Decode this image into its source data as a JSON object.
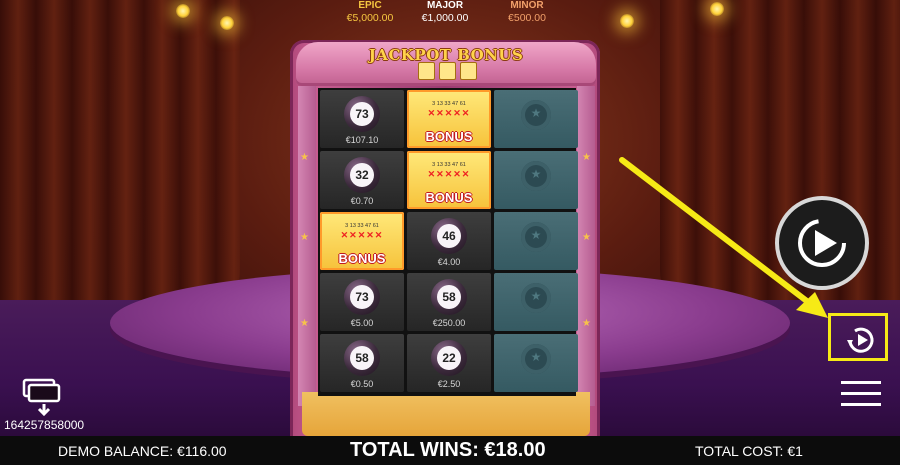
{
  "jackpots": [
    {
      "label": "EPIC",
      "value": "€5,000.00",
      "color": "#f6c640"
    },
    {
      "label": "MAJOR",
      "value": "€1,000.00",
      "color": "#ffffff"
    },
    {
      "label": "MINOR",
      "value": "€500.00",
      "color": "#f2a06a"
    }
  ],
  "game": {
    "title": "JACKPOT BONUS",
    "grid": [
      [
        {
          "type": "ball",
          "number": "73",
          "prize": "€107.10"
        },
        {
          "type": "bonus",
          "label": "BONUS"
        },
        {
          "type": "empty"
        }
      ],
      [
        {
          "type": "ball",
          "number": "32",
          "prize": "€0.70"
        },
        {
          "type": "bonus",
          "label": "BONUS"
        },
        {
          "type": "empty"
        }
      ],
      [
        {
          "type": "bonus",
          "label": "BONUS"
        },
        {
          "type": "ball",
          "number": "46",
          "prize": "€4.00"
        },
        {
          "type": "empty"
        }
      ],
      [
        {
          "type": "ball",
          "number": "73",
          "prize": "€5.00"
        },
        {
          "type": "ball",
          "number": "58",
          "prize": "€250.00"
        },
        {
          "type": "empty"
        }
      ],
      [
        {
          "type": "ball",
          "number": "58",
          "prize": "€0.50"
        },
        {
          "type": "ball",
          "number": "22",
          "prize": "€2.50"
        },
        {
          "type": "empty"
        }
      ]
    ],
    "bonus_card_numbers": "3 13 33 47 61"
  },
  "controls": {
    "play_icon": "play-icon",
    "replay_icon": "replay-icon",
    "menu_icon": "hamburger-menu-icon",
    "wallet_icon": "wallet-icon",
    "highlight_color": "#f6ea16"
  },
  "ticket_id": "164257858000",
  "bottom_bar": {
    "balance": "DEMO BALANCE: €116.00",
    "total_wins": "TOTAL WINS: €18.00",
    "total_cost": "TOTAL COST: €1"
  }
}
